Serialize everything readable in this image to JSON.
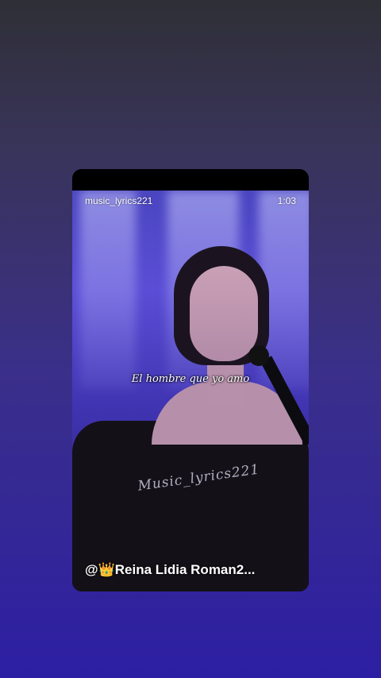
{
  "story": {
    "username": "music_lyrics221",
    "duration": "1:03",
    "lyric": "El hombre que yo amo",
    "watermark": "Music_lyrics221",
    "creator_tag": "@👑Reina Lidia Roman2..."
  },
  "colors": {
    "background_top": "#2f2f36",
    "background_bottom": "#2d1fa3",
    "text": "#ffffff"
  }
}
